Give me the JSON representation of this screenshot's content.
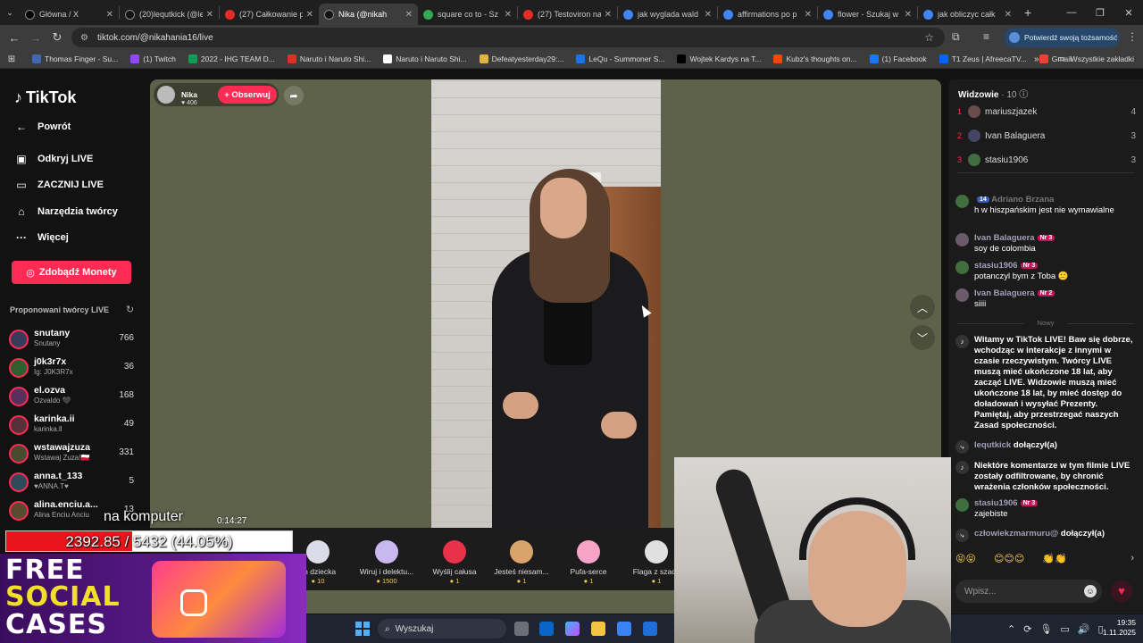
{
  "browser": {
    "tabs": [
      {
        "title": "Główna / X",
        "color": "#000000"
      },
      {
        "title": "(20)lequtkick (@le",
        "color": "#111111"
      },
      {
        "title": "(27) Całkowanie p",
        "color": "#e52d27"
      },
      {
        "title": "Nika (@nikah",
        "color": "#111111",
        "active": true
      },
      {
        "title": "square co to - Sz",
        "color": "#34a853"
      },
      {
        "title": "(27) Testoviron na",
        "color": "#e52d27"
      },
      {
        "title": "jak wyglada wald",
        "color": "#4285f4"
      },
      {
        "title": "affirmations po p",
        "color": "#4285f4"
      },
      {
        "title": "flower - Szukaj w",
        "color": "#4285f4"
      },
      {
        "title": "jak obliczyc całk",
        "color": "#4285f4"
      }
    ],
    "new_tab": "+",
    "url": "tiktok.com/@nikahania16/live",
    "verify_label": "Potwierdź swoją tożsamość",
    "bookmarks": [
      {
        "label": "Thomas Finger - Su...",
        "color": "#4267b2"
      },
      {
        "label": "(1) Twitch",
        "color": "#9146ff"
      },
      {
        "label": "2022 - IHG TEAM D...",
        "color": "#0f9d58"
      },
      {
        "label": "Naruto i Naruto Shi...",
        "color": "#e52d27"
      },
      {
        "label": "Naruto i Naruto Shi...",
        "color": "#ffffff"
      },
      {
        "label": "Defeatyesterday29:...",
        "color": "#e3b341"
      },
      {
        "label": "LeQu - Summoner S...",
        "color": "#1a73e8"
      },
      {
        "label": "Wojtek Kardys na T...",
        "color": "#000000"
      },
      {
        "label": "Kubz's thoughts on...",
        "color": "#ff4500"
      },
      {
        "label": "(1) Facebook",
        "color": "#1877f2"
      },
      {
        "label": "T1 Zeus | AfreecaTV...",
        "color": "#0066ff"
      },
      {
        "label": "Gmail",
        "color": "#ea4335"
      }
    ],
    "all_bookmarks": "Wszystkie zakładki"
  },
  "sidebar": {
    "brand": "TikTok",
    "nav": [
      {
        "label": "Powrót",
        "icon": "←"
      },
      {
        "label": "Odkryj LIVE",
        "icon": "▣"
      },
      {
        "label": "ZACZNIJ LIVE",
        "icon": "▭"
      },
      {
        "label": "Narzędzia twórcy",
        "icon": "⌂"
      },
      {
        "label": "Więcej",
        "icon": "···"
      }
    ],
    "coins_button": "Zdobądź Monety",
    "suggested_title": "Proponowani twórcy LIVE",
    "creators": [
      {
        "name": "snutany",
        "sub": "Snutany",
        "count": "766"
      },
      {
        "name": "j0k3r7x",
        "sub": "Ig: J0K3R7x",
        "count": "36"
      },
      {
        "name": "el.ozva",
        "sub": "Ozvaldo 🖤",
        "count": "168"
      },
      {
        "name": "karinka.ii",
        "sub": "karinka.ll",
        "count": "49"
      },
      {
        "name": "wstawajzuza",
        "sub": "Wstawaj Zuza!🇵🇱",
        "count": "331"
      },
      {
        "name": "anna.t_133",
        "sub": "♥ANNA.T♥",
        "count": "5"
      },
      {
        "name": "alina.enciu.a...",
        "sub": "Alina Enciu Anciu",
        "count": "13"
      }
    ]
  },
  "stream": {
    "host_name": "Nika",
    "host_likes": "♥ 406",
    "follow_label": "+ Obserwuj",
    "gifts": [
      {
        "name": "ch dziecka",
        "price": "10"
      },
      {
        "name": "Wiruj i delektu...",
        "price": "1500"
      },
      {
        "name": "Wyślij całusa",
        "price": "1"
      },
      {
        "name": "Jesteś niesam...",
        "price": "1"
      },
      {
        "name": "Pufa-serce",
        "price": "1"
      },
      {
        "name": "Flaga z szach",
        "price": "1"
      }
    ]
  },
  "panel": {
    "viewers_title": "Widzowie",
    "viewers_count": "· 10",
    "top_viewers": [
      {
        "rank": "1",
        "name": "mariuszjazek",
        "score": "4"
      },
      {
        "rank": "2",
        "name": "Ivan Balaguera",
        "score": "3"
      },
      {
        "rank": "3",
        "name": "stasiu1906",
        "score": "3"
      }
    ],
    "chat": [
      {
        "user": "Adriano Brzana",
        "badge": "14",
        "text": "h w hiszpańskim jest nie wymawialne"
      },
      {
        "user": "Ivan Balaguera",
        "badge": "Nr 3",
        "text": "soy de colombia"
      },
      {
        "user": "stasiu1906",
        "badge": "Nr 3",
        "text": "potanczyl bym z Toba 🙂"
      },
      {
        "user": "Ivan Balaguera",
        "badge": "Nr 2",
        "text": "siiii"
      }
    ],
    "new_label": "Nowy",
    "welcome": "Witamy w TikTok LIVE! Baw się dobrze, wchodząc w interakcje z innymi w czasie rzeczywistym. Twórcy LIVE muszą mieć ukończone 18 lat, aby zacząć LIVE. Widzowie muszą mieć ukończone 18 lat, by mieć dostęp do doładowań i wysyłać Prezenty. Pamiętaj, aby przestrzegać naszych Zasad społeczności.",
    "join1_user": "lequtkick",
    "join1_text": "dołączył(a)",
    "filtered": "Niektóre komentarze w tym filmie LIVE zostały odfiltrowane, by chronić wrażenia członków społeczności.",
    "last_user": "stasiu1906",
    "last_badge": "Nr 3",
    "last_text": "zajebiste",
    "join2_user": "człowiekzmarmuru@",
    "join2_text": "dołączył(a)",
    "input_placeholder": "Wpisz..."
  },
  "overlay": {
    "caption": "na komputer",
    "timer": "0:14:27",
    "progress_text": "2392.85 / 5432 (44.05%)",
    "progress_pct": 44.05,
    "promo_line1": "FREE",
    "promo_line2": "SOCIAL",
    "promo_line3": "CASES"
  },
  "taskbar": {
    "search": "Wyszukaj",
    "time": "19:35",
    "date": "1.11.2025"
  }
}
